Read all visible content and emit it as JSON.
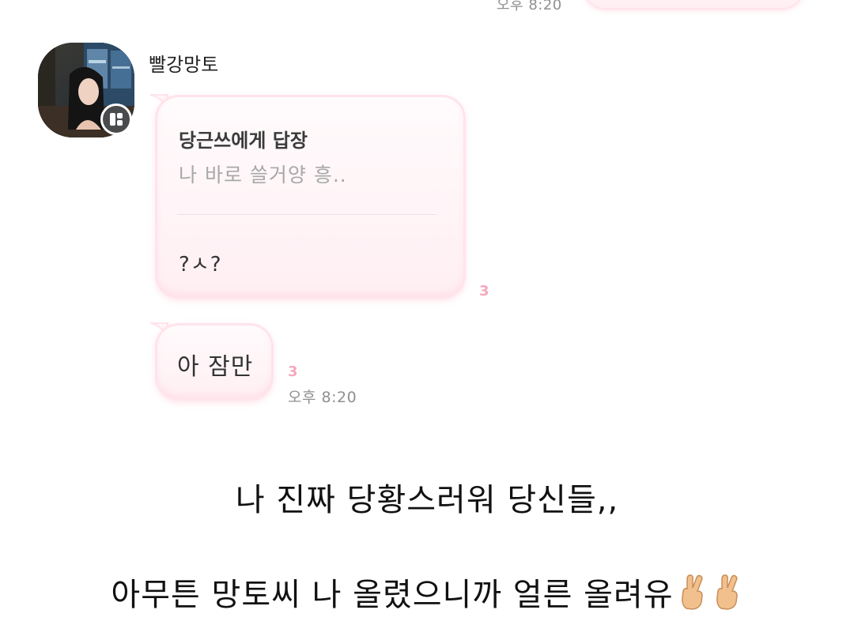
{
  "top_message": {
    "time": "오후 8:20"
  },
  "sender": {
    "name": "빨강망토"
  },
  "messages": [
    {
      "reply_header": "당근쓰에게 답장",
      "quoted_text": "나 바로 쓸거양 흥..",
      "text": "?ㅅ?",
      "unread_count": "3"
    },
    {
      "text": "아 잠만",
      "unread_count": "3",
      "time": "오후 8:20"
    }
  ],
  "captions": {
    "line1": "나 진짜 당황스러워 당신들,,",
    "line2": "아무튼 망토씨 나 올렸으니까 얼른 올려유",
    "line2_emoji": "victory-hand-emoji"
  },
  "colors": {
    "bubble_fill": "#fff0f3",
    "bubble_border": "#ffe4eb",
    "unread_count": "#f5a9bd",
    "timestamp": "#8f8f8f"
  }
}
